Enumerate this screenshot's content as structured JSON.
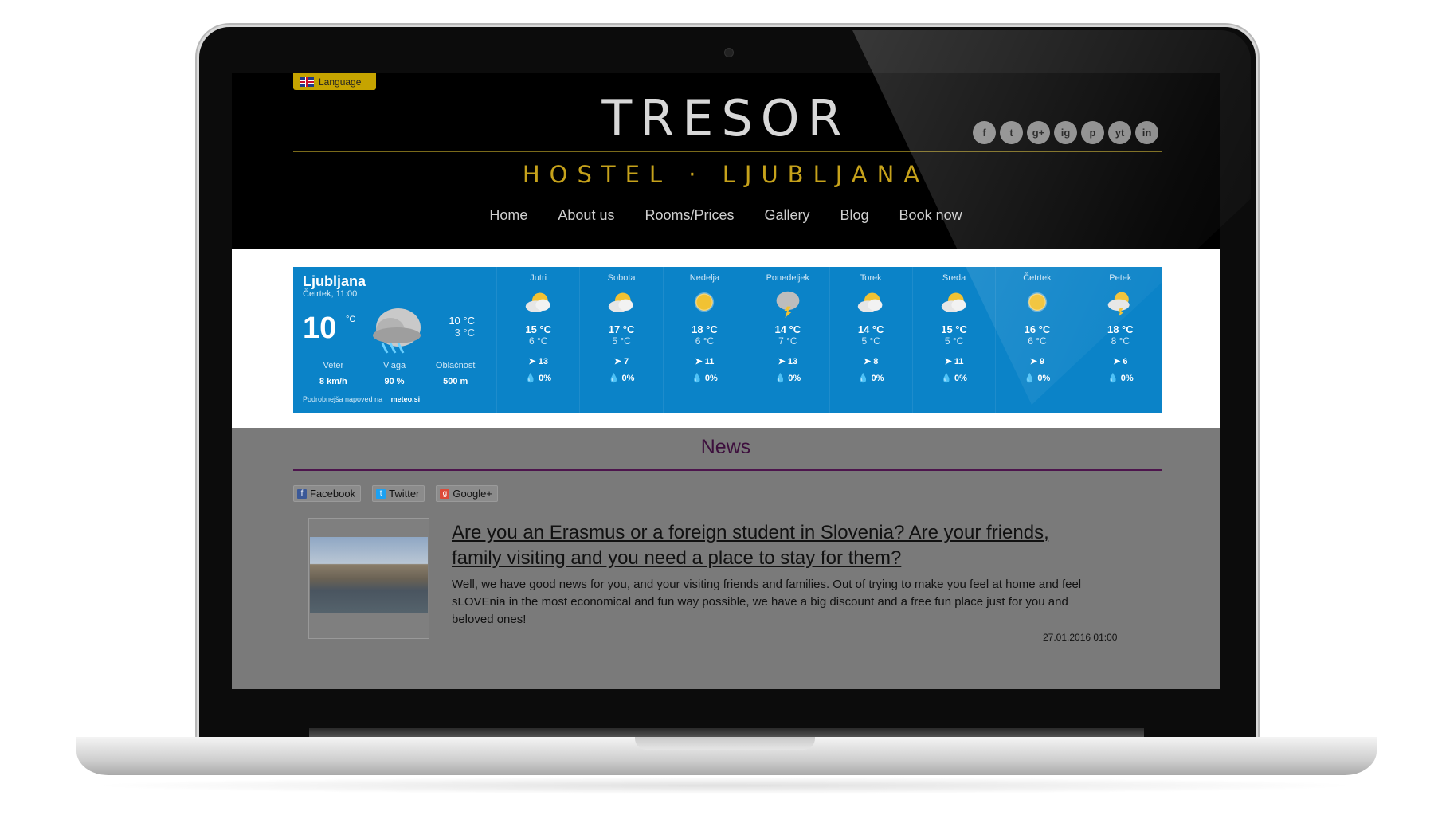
{
  "header": {
    "language_label": "Language",
    "logo": "TRESOR",
    "subtitle": "HOSTEL · LJUBLJANA",
    "social": [
      "f",
      "t",
      "g+",
      "ig",
      "p",
      "yt",
      "in"
    ]
  },
  "nav": {
    "items": [
      "Home",
      "About us",
      "Rooms/Prices",
      "Gallery",
      "Blog",
      "Book now"
    ]
  },
  "weather": {
    "city": "Ljubljana",
    "time": "Četrtek, 11:00",
    "temp": "10",
    "unit": "°C",
    "high": "10 °C",
    "low": "3 °C",
    "labels": [
      "Veter",
      "Vlaga",
      "Oblačnost"
    ],
    "values": [
      "8 km/h",
      "90 %",
      "500 m"
    ],
    "more_text": "Podrobnejša napoved na",
    "more_link": "meteo.si",
    "days": [
      {
        "name": "Jutri",
        "high": "15 °C",
        "low": "6 °C",
        "wind": "13",
        "rain": "0%",
        "icon": "partly-cloudy-icon"
      },
      {
        "name": "Sobota",
        "high": "17 °C",
        "low": "5 °C",
        "wind": "7",
        "rain": "0%",
        "icon": "partly-cloudy-icon"
      },
      {
        "name": "Nedelja",
        "high": "18 °C",
        "low": "6 °C",
        "wind": "11",
        "rain": "0%",
        "icon": "sun-icon"
      },
      {
        "name": "Ponedeljek",
        "high": "14 °C",
        "low": "7 °C",
        "wind": "13",
        "rain": "0%",
        "icon": "thunderstorm-icon"
      },
      {
        "name": "Torek",
        "high": "14 °C",
        "low": "5 °C",
        "wind": "8",
        "rain": "0%",
        "icon": "partly-cloudy-icon"
      },
      {
        "name": "Sreda",
        "high": "15 °C",
        "low": "5 °C",
        "wind": "11",
        "rain": "0%",
        "icon": "partly-cloudy-icon"
      },
      {
        "name": "Četrtek",
        "high": "16 °C",
        "low": "6 °C",
        "wind": "9",
        "rain": "0%",
        "icon": "sun-icon"
      },
      {
        "name": "Petek",
        "high": "18 °C",
        "low": "8 °C",
        "wind": "6",
        "rain": "0%",
        "icon": "sun-storm-icon"
      }
    ]
  },
  "news": {
    "title": "News",
    "share": [
      "Facebook",
      "Twitter",
      "Google+"
    ],
    "headline": "Are you an Erasmus or a foreign student in Slovenia? Are your friends, family visiting and you need a place to stay for them?",
    "excerpt": "Well, we have good news for you, and your visiting friends and families. Out of trying to make you feel at home and feel sLOVEnia in the most economical and fun way possible, we have a big discount and a free fun place just for you and beloved ones!",
    "date": "27.01.2016 01:00"
  },
  "colors": {
    "gold": "#c6a21b",
    "weather_blue": "#0b83c8",
    "news_purple": "#3d0f3d",
    "news_bg": "#7a7a7a"
  }
}
